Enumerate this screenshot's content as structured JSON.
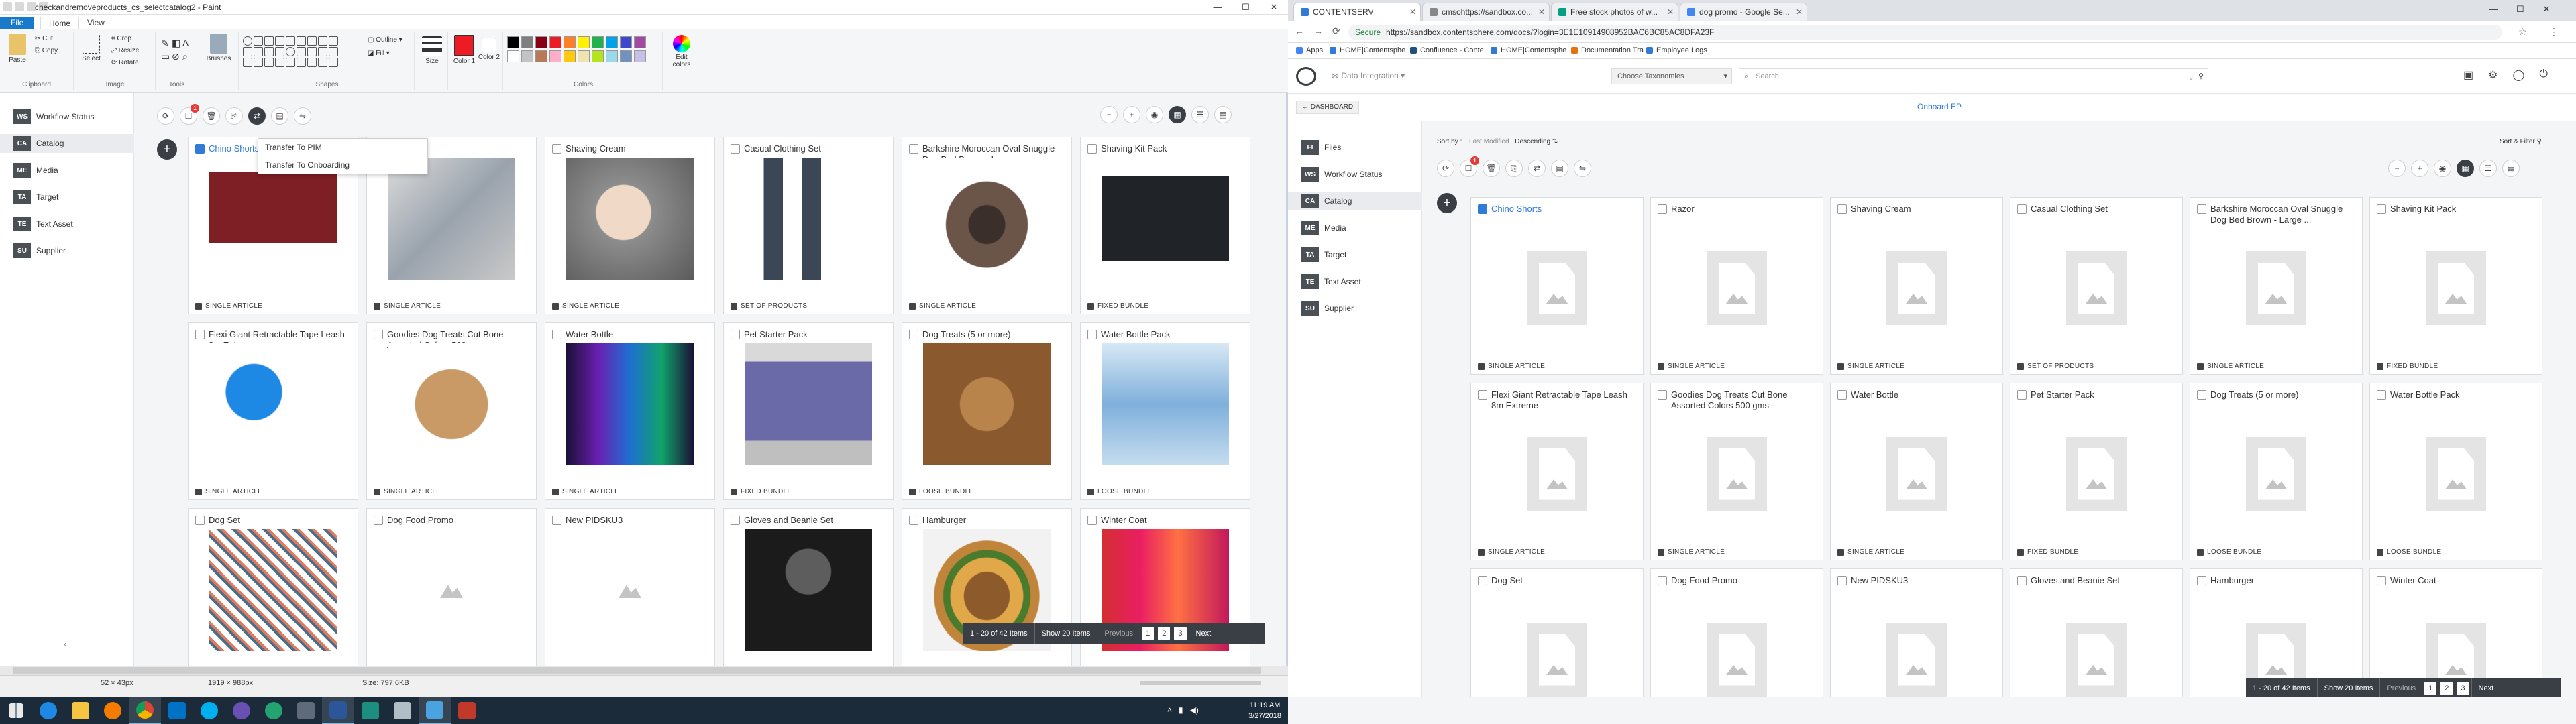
{
  "paint": {
    "title": "checkandremoveproducts_cs_selectcatalog2 - Paint",
    "tabs": [
      "File",
      "Home",
      "View"
    ],
    "ribbon": {
      "clipboard": {
        "label": "Clipboard",
        "paste": "Paste",
        "cut": "Cut",
        "copy": "Copy"
      },
      "image": {
        "label": "Image",
        "select": "Select",
        "crop": "Crop",
        "resize": "Resize",
        "rotate": "Rotate"
      },
      "tools": {
        "label": "Tools"
      },
      "brushes": "Brushes",
      "shapes": {
        "label": "Shapes",
        "outline": "Outline",
        "fill": "Fill"
      },
      "size": "Size",
      "color1": "Color 1",
      "color2": "Color 2",
      "colors_label": "Colors",
      "edit_colors": "Edit colors",
      "palette": [
        "#000000",
        "#7f7f7f",
        "#880015",
        "#ed1c24",
        "#ff7f27",
        "#fff200",
        "#22b14c",
        "#00a2e8",
        "#3f48cc",
        "#a349a4",
        "#ffffff",
        "#c3c3c3",
        "#b97a57",
        "#ffaec9",
        "#ffc90e",
        "#efe4b0",
        "#b5e61d",
        "#99d9ea",
        "#7092be",
        "#c8bfe7"
      ]
    },
    "status": {
      "cursor": "52 × 43px",
      "selection": "1919 × 988px",
      "size": "Size: 797.6KB"
    }
  },
  "app_left": {
    "sidebar": [
      {
        "badge": "WS",
        "label": "Workflow Status"
      },
      {
        "badge": "CA",
        "label": "Catalog"
      },
      {
        "badge": "ME",
        "label": "Media"
      },
      {
        "badge": "TA",
        "label": "Target"
      },
      {
        "badge": "TE",
        "label": "Text Asset"
      },
      {
        "badge": "SU",
        "label": "Supplier"
      }
    ],
    "popup": [
      "Transfer To PIM",
      "Transfer To Onboarding"
    ],
    "badge_count": "1",
    "pager": {
      "range": "1 - 20 of 42 Items",
      "show": "Show 20 Items",
      "prev": "Previous",
      "pages": [
        "1",
        "2",
        "3"
      ],
      "next": "Next"
    }
  },
  "products": [
    {
      "name": "Chino Shorts",
      "type": "SINGLE ARTICLE",
      "selected": true
    },
    {
      "name": "Razor",
      "type": "SINGLE ARTICLE"
    },
    {
      "name": "Shaving Cream",
      "type": "SINGLE ARTICLE"
    },
    {
      "name": "Casual Clothing Set",
      "type": "SET OF PRODUCTS"
    },
    {
      "name": "Barkshire Moroccan Oval Snuggle Dog Bed Brown - Large ...",
      "type": "SINGLE ARTICLE"
    },
    {
      "name": "Shaving Kit Pack",
      "type": "FIXED BUNDLE"
    },
    {
      "name": "Flexi Giant Retractable Tape Leash 8m Extreme",
      "type": "SINGLE ARTICLE"
    },
    {
      "name": "Goodies Dog Treats Cut Bone Assorted Colors 500 gms",
      "type": "SINGLE ARTICLE"
    },
    {
      "name": "Water Bottle",
      "type": "SINGLE ARTICLE"
    },
    {
      "name": "Pet Starter Pack",
      "type": "FIXED BUNDLE"
    },
    {
      "name": "Dog Treats (5 or more)",
      "type": "LOOSE BUNDLE"
    },
    {
      "name": "Water Bottle Pack",
      "type": "LOOSE BUNDLE"
    },
    {
      "name": "Dog Set",
      "type": ""
    },
    {
      "name": "Dog Food Promo",
      "type": ""
    },
    {
      "name": "New PIDSKU3",
      "type": ""
    },
    {
      "name": "Gloves and Beanie Set",
      "type": ""
    },
    {
      "name": "Hamburger",
      "type": ""
    },
    {
      "name": "Winter Coat",
      "type": ""
    }
  ],
  "browser": {
    "tabs": [
      {
        "title": "CONTENTSERV",
        "color": "#2f7bd6"
      },
      {
        "title": "cmsohttps://sandbox.co...",
        "color": "#888888"
      },
      {
        "title": "Free stock photos of w...",
        "color": "#05a081"
      },
      {
        "title": "dog promo - Google Se...",
        "color": "#4285f4"
      }
    ],
    "secure": "Secure",
    "url": "https://sandbox.contentsphere.com/docs/?login=3E1E10914908952BAC6BC85AC8DFA23F",
    "bookmarks": [
      "Apps",
      "HOME|Contentsphe",
      "Confluence - Conte",
      "HOME|Contentsphe",
      "Documentation Tra",
      "Employee Logs"
    ],
    "header": {
      "module": "Data Integration",
      "taxonomy": "Choose Taxonomies",
      "search_placeholder": "Search..."
    },
    "dashboard": "DASHBOARD",
    "page_title": "Onboard EP",
    "sort": {
      "label": "Sort by :",
      "field": "Last Modified",
      "order": "Descending",
      "filter": "Sort & Filter"
    },
    "sidebar": [
      {
        "badge": "FI",
        "label": "Files"
      },
      {
        "badge": "WS",
        "label": "Workflow Status"
      },
      {
        "badge": "CA",
        "label": "Catalog"
      },
      {
        "badge": "ME",
        "label": "Media"
      },
      {
        "badge": "TA",
        "label": "Target"
      },
      {
        "badge": "TE",
        "label": "Text Asset"
      },
      {
        "badge": "SU",
        "label": "Supplier"
      }
    ],
    "pager": {
      "range": "1 - 20 of 42 Items",
      "show": "Show 20 Items",
      "prev": "Previous",
      "pages": [
        "1",
        "2",
        "3"
      ],
      "next": "Next"
    }
  },
  "taskbar": {
    "time": "11:19 AM",
    "date": "3/27/2018"
  }
}
